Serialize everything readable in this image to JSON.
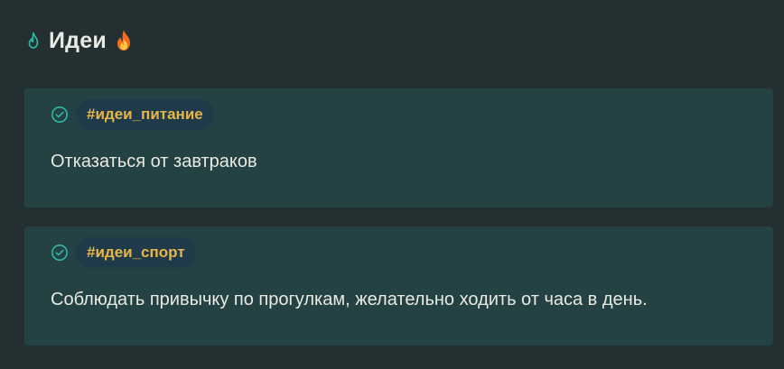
{
  "header": {
    "title": "Идеи",
    "left_icon": "flame-outline-icon",
    "right_icon": "fire-emoji"
  },
  "cards": [
    {
      "tag": "#идеи_питание",
      "text": "Отказаться от завтраков",
      "icon": "check-circle-icon"
    },
    {
      "tag": "#идеи_спорт",
      "text": "Соблюдать привычку по прогулкам, желательно ходить от часа в день.",
      "icon": "check-circle-icon"
    }
  ],
  "colors": {
    "background": "#232f31",
    "card": "#244244",
    "tag_bg": "#1f3a48",
    "tag_text": "#e8b548",
    "accent": "#2fb7a5"
  }
}
